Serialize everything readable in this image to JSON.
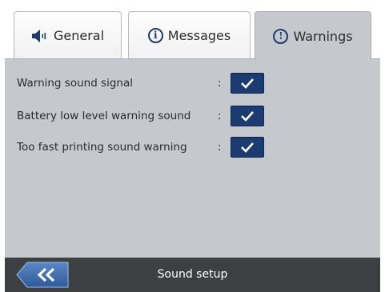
{
  "tabs": [
    {
      "label": "General",
      "icon": "speaker-icon",
      "active": false
    },
    {
      "label": "Messages",
      "icon": "info-icon",
      "active": false
    },
    {
      "label": "Warnings",
      "icon": "exclamation-icon",
      "active": true
    }
  ],
  "settings": [
    {
      "label": "Warning sound signal",
      "separator": ":",
      "checked": true
    },
    {
      "label": "Battery low level warning sound",
      "separator": ":",
      "checked": true
    },
    {
      "label": "Too fast printing sound warning",
      "separator": ":",
      "checked": true
    }
  ],
  "footer": {
    "title": "Sound setup",
    "back_icon": "double-chevron-left-icon"
  },
  "colors": {
    "panel": "#c5c8cc",
    "checkbox": "#1c3b70",
    "footer": "#3d4043",
    "accent": "#1e3a6e"
  }
}
